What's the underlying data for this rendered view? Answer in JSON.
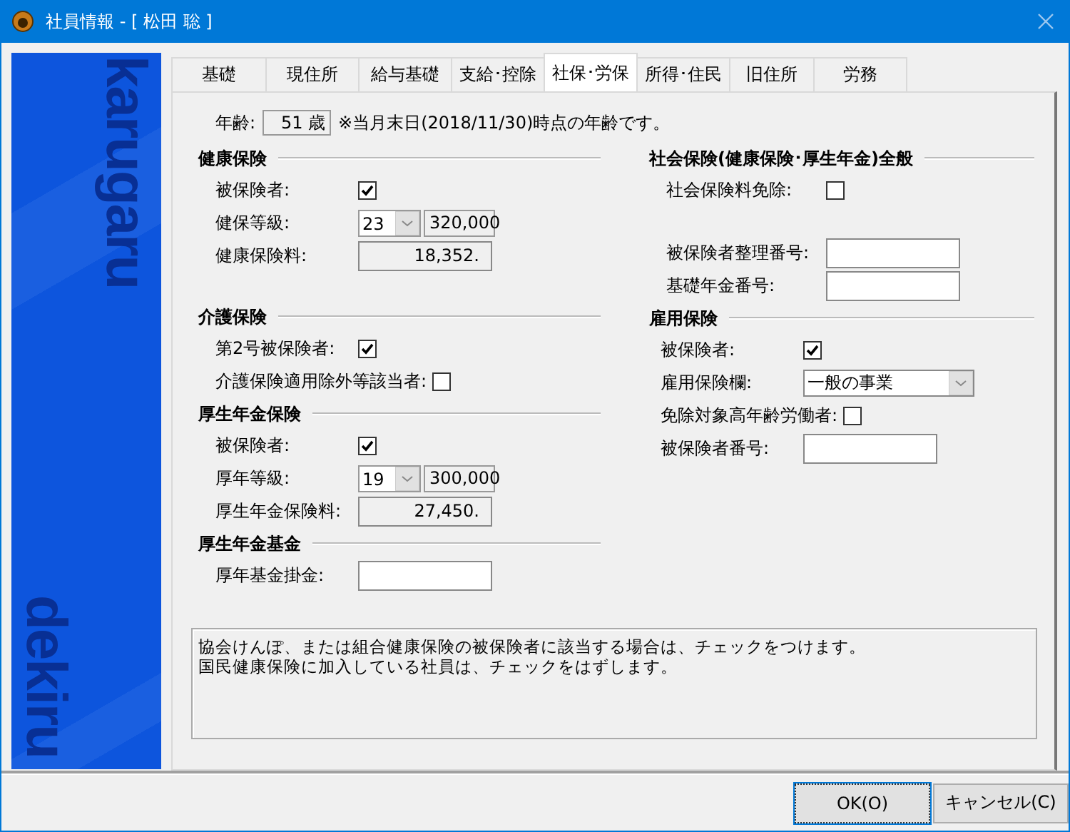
{
  "window": {
    "title": "社員情報 - [ 松田 聡 ]"
  },
  "sidebar": {
    "logo_words": [
      "karugaru",
      "dekiru"
    ]
  },
  "tabs": [
    {
      "label": "基礎",
      "selected": false
    },
    {
      "label": "現住所",
      "selected": false
    },
    {
      "label": "給与基礎",
      "selected": false
    },
    {
      "label": "支給･控除",
      "selected": false
    },
    {
      "label": "社保･労保",
      "selected": true
    },
    {
      "label": "所得･住民",
      "selected": false
    },
    {
      "label": "旧住所",
      "selected": false
    },
    {
      "label": "労務",
      "selected": false
    }
  ],
  "age": {
    "label": "年齢:",
    "value": "51 歳",
    "note": "※当月末日(2018/11/30)時点の年齢です。"
  },
  "left_sections": [
    {
      "title": "健康保険",
      "rows": [
        {
          "kind": "checkbox",
          "label": "被保険者:",
          "checked": true
        },
        {
          "kind": "grade",
          "label": "健保等級:",
          "grade": "23",
          "amount": "320,000"
        },
        {
          "kind": "readonly",
          "label": "健康保険料:",
          "value": "18,352."
        }
      ]
    },
    {
      "title": "介護保険",
      "rows": [
        {
          "kind": "checkbox",
          "label": "第2号被保険者:",
          "checked": true
        },
        {
          "kind": "checkbox",
          "label": "介護保険適用除外等該当者:",
          "checked": false
        }
      ]
    },
    {
      "title": "厚生年金保険",
      "rows": [
        {
          "kind": "checkbox",
          "label": "被保険者:",
          "checked": true
        },
        {
          "kind": "grade",
          "label": "厚年等級:",
          "grade": "19",
          "amount": "300,000"
        },
        {
          "kind": "readonly",
          "label": "厚生年金保険料:",
          "value": "27,450."
        }
      ]
    },
    {
      "title": "厚生年金基金",
      "rows": [
        {
          "kind": "text",
          "label": "厚年基金掛金:"
        }
      ]
    }
  ],
  "right_sections": [
    {
      "title": "社会保険(健康保険･厚生年金)全般",
      "rows": [
        {
          "kind": "checkbox",
          "label": "社会保険料免除:",
          "checked": false
        },
        {
          "kind": "text",
          "label": "被保険者整理番号:"
        },
        {
          "kind": "text",
          "label": "基礎年金番号:"
        }
      ]
    },
    {
      "title": "雇用保険",
      "rows": [
        {
          "kind": "checkbox",
          "label": "被保険者:",
          "checked": true
        },
        {
          "kind": "select",
          "label": "雇用保険欄:",
          "value": "一般の事業"
        },
        {
          "kind": "checkbox",
          "label": "免除対象高年齢労働者:",
          "checked": false
        },
        {
          "kind": "text",
          "label": "被保険者番号:"
        }
      ]
    }
  ],
  "help_text": [
    "協会けんぽ、または組合健康保険の被保険者に該当する場合は、チェックをつけます。",
    "国民健康保険に加入している社員は、チェックをはずします。"
  ],
  "buttons": [
    "OK(O)",
    "キャンセル(C)"
  ]
}
